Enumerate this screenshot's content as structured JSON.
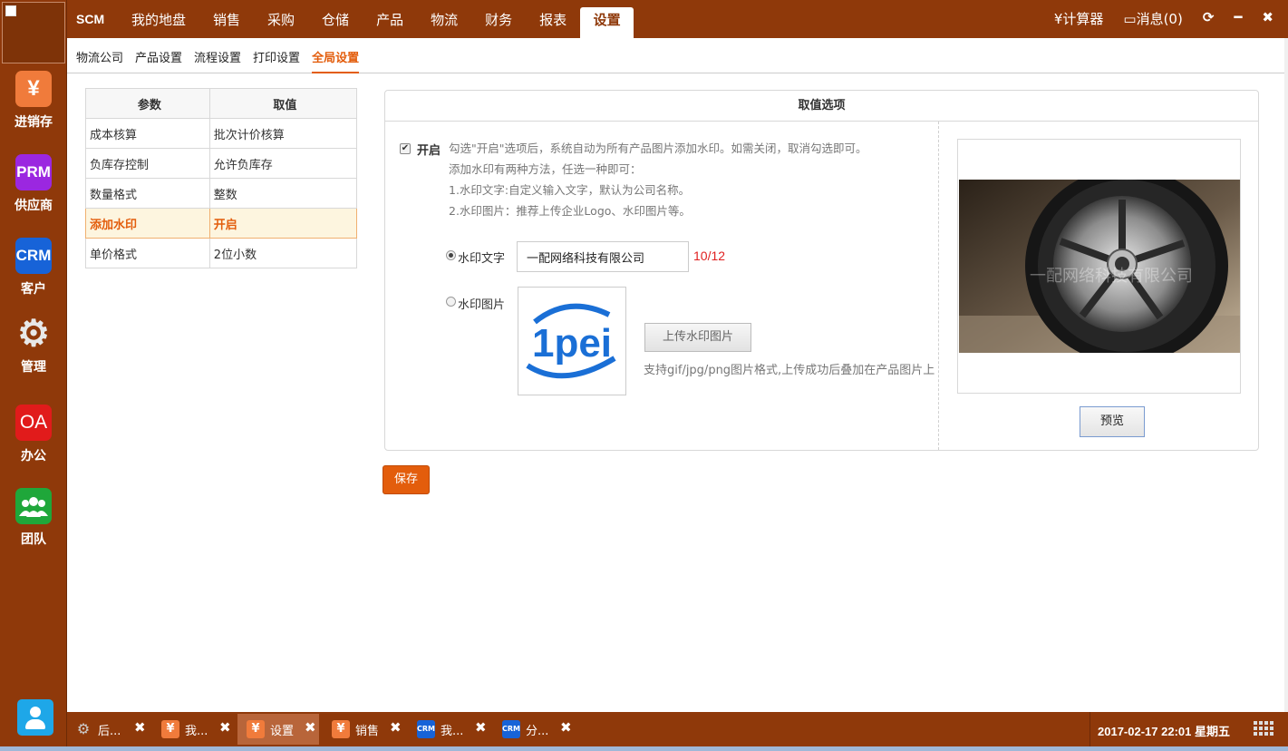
{
  "sidebar": {
    "items": [
      {
        "icon": "¥",
        "label": "进销存",
        "color": "#f07b3b"
      },
      {
        "icon": "PRM",
        "label": "供应商",
        "color": "#9b27e0"
      },
      {
        "icon": "CRM",
        "label": "客户",
        "color": "#1763d8"
      },
      {
        "icon": "⚙",
        "label": "管理",
        "color": "transparent"
      },
      {
        "icon": "OA",
        "label": "办公",
        "color": "#e11b1b"
      },
      {
        "icon": "",
        "label": "团队",
        "color": "#1fa73a"
      }
    ]
  },
  "header": {
    "brand": "SCM",
    "nav": [
      "我的地盘",
      "销售",
      "采购",
      "仓储",
      "产品",
      "物流",
      "财务",
      "报表",
      "设置"
    ],
    "active_nav": "设置",
    "calculator": "¥计算器",
    "messages": "消息(0)"
  },
  "subnav": {
    "items": [
      "物流公司",
      "产品设置",
      "流程设置",
      "打印设置",
      "全局设置"
    ],
    "active": "全局设置"
  },
  "params": {
    "headers": [
      "参数",
      "取值"
    ],
    "rows": [
      [
        "成本核算",
        "批次计价核算"
      ],
      [
        "负库存控制",
        "允许负库存"
      ],
      [
        "数量格式",
        "整数"
      ],
      [
        "添加水印",
        "开启"
      ],
      [
        "单价格式",
        "2位小数"
      ]
    ],
    "selected_index": 3
  },
  "options": {
    "title": "取值选项",
    "enable_label": "开启",
    "enable_checked": true,
    "desc": [
      "勾选\"开启\"选项后，系统自动为所有产品图片添加水印。如需关闭，取消勾选即可。",
      "添加水印有两种方法，任选一种即可：",
      "1.水印文字:自定义输入文字，默认为公司名称。",
      "2.水印图片：推荐上传企业Logo、水印图片等。"
    ],
    "text_radio_label": "水印文字",
    "text_value": "一配网络科技有限公司",
    "counter": "10/12",
    "image_radio_label": "水印图片",
    "logo_text": "1pei",
    "upload_label": "上传水印图片",
    "upload_hint": "支持gif/jpg/png图片格式,上传成功后叠加在产品图片上",
    "preview_watermark": "一配网络科技有限公司",
    "preview_label": "预览"
  },
  "save_label": "保存",
  "taskbar": {
    "tabs": [
      {
        "icon": "gear",
        "label": "后..."
      },
      {
        "icon": "¥",
        "label": "我..."
      },
      {
        "icon": "¥",
        "label": "设置"
      },
      {
        "icon": "¥",
        "label": "销售"
      },
      {
        "icon": "CRM",
        "label": "我..."
      },
      {
        "icon": "CRM",
        "label": "分..."
      }
    ],
    "active_index": 2,
    "datetime": "2017-02-17 22:01 星期五"
  },
  "colors": {
    "brand": "#8f390a",
    "accent": "#e35d0c",
    "counter": "#e02020"
  }
}
